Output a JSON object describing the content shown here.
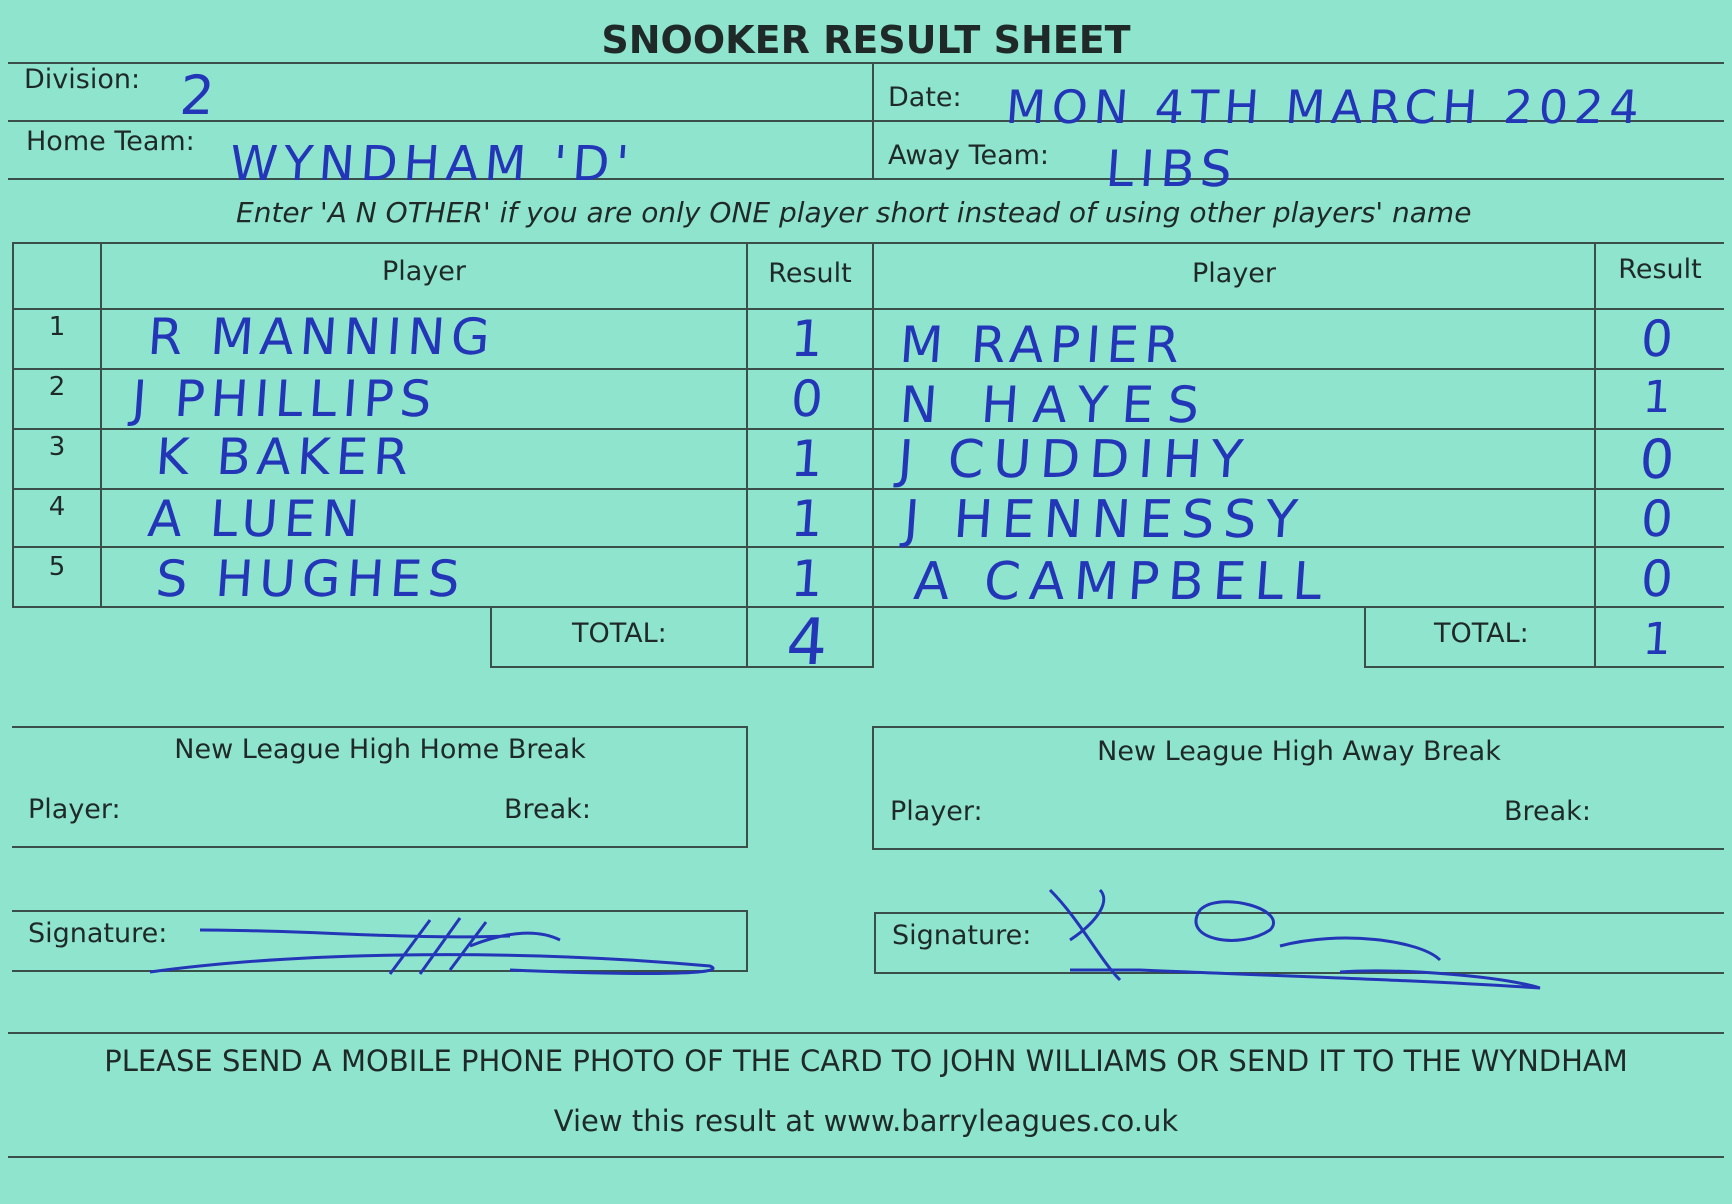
{
  "sheet": {
    "title": "SNOOKER RESULT SHEET",
    "division_label": "Division:",
    "division_value": "2",
    "date_label": "Date:",
    "date_value": "MON 4TH MARCH 2024",
    "home_team_label": "Home Team:",
    "home_team_value": "WYNDHAM 'D'",
    "away_team_label": "Away Team:",
    "away_team_value": "LIBS",
    "instruction": "Enter 'A N OTHER' if you are only ONE player short instead of using other players' name"
  },
  "table": {
    "player_header": "Player",
    "result_header": "Result",
    "rows": [
      {
        "num": "1",
        "home_player": "R MANNING",
        "home_result": "1",
        "away_player": "M RAPIER",
        "away_result": "0"
      },
      {
        "num": "2",
        "home_player": "J PHILLIPS",
        "home_result": "0",
        "away_player": "N HAYES",
        "away_result": "1"
      },
      {
        "num": "3",
        "home_player": "K BAKER",
        "home_result": "1",
        "away_player": "J CUDDIHY",
        "away_result": "0"
      },
      {
        "num": "4",
        "home_player": "A LUEN",
        "home_result": "1",
        "away_player": "J HENNESSY",
        "away_result": "0"
      },
      {
        "num": "5",
        "home_player": "S HUGHES",
        "home_result": "1",
        "away_player": "A CAMPBELL",
        "away_result": "0"
      }
    ],
    "total_label": "TOTAL:",
    "home_total": "4",
    "away_total": "1"
  },
  "breaks": {
    "home_title": "New League High Home Break",
    "away_title": "New League High Away Break",
    "player_label": "Player:",
    "break_label": "Break:"
  },
  "signatures": {
    "label": "Signature:"
  },
  "footer": {
    "notice": "PLEASE SEND A MOBILE PHONE PHOTO OF THE CARD TO JOHN WILLIAMS OR SEND IT TO THE WYNDHAM",
    "website": "View this result at www.barryleagues.co.uk"
  },
  "colors": {
    "card": "#8fe4ce",
    "ink": "#2436b8",
    "print": "#1f2a28"
  }
}
